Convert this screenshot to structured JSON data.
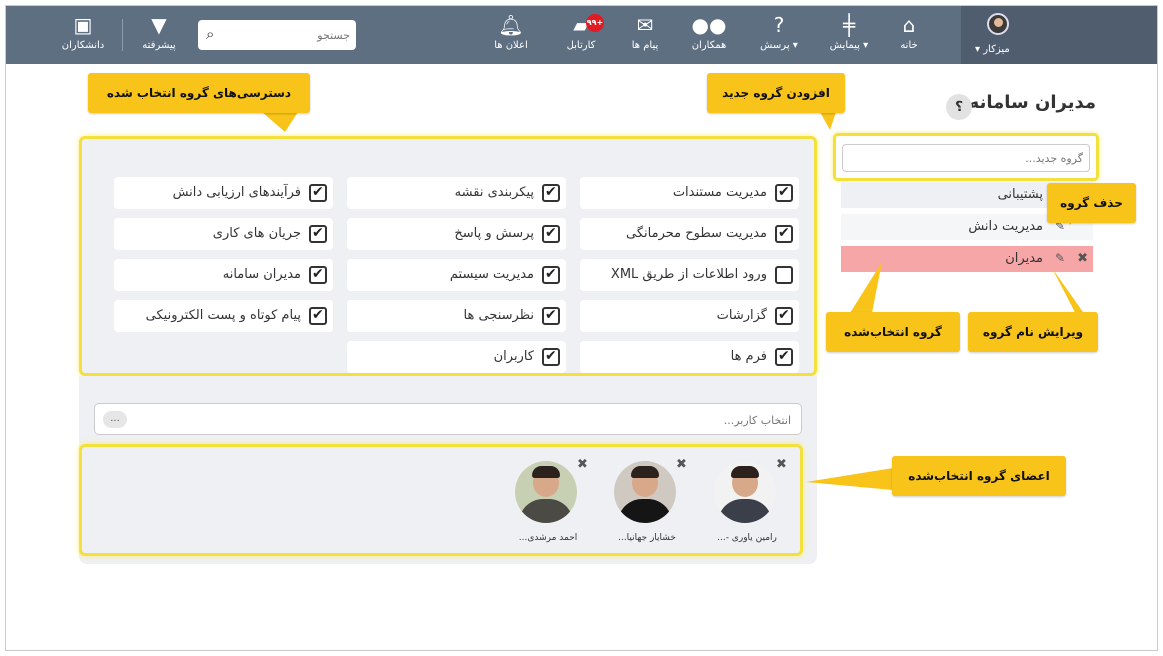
{
  "nav": {
    "user_name": "میزکار",
    "home": "خانه",
    "survey": "پیمایش",
    "question": "پرسش",
    "colleagues": "همکاران",
    "messages": "پیام ها",
    "cartable": "کارتابل",
    "cartable_badge": "۹۹+",
    "notifications": "اعلان ها",
    "search_placeholder": "جستجو",
    "advanced": "پیشرفته",
    "academics": "دانشکاران"
  },
  "groups": {
    "title": "مدیران سامانه",
    "help": "؟",
    "new_group_placeholder": "گروه جدید...",
    "items": [
      {
        "name": "پشتیبانی"
      },
      {
        "name": "مدیریت دانش"
      },
      {
        "name": "مدیران"
      }
    ]
  },
  "permissions": [
    {
      "label": "مدیریت مستندات",
      "checked": true
    },
    {
      "label": "پیکربندی نقشه",
      "checked": true
    },
    {
      "label": "فرآیندهای ارزیابی دانش",
      "checked": true
    },
    {
      "label": "مدیریت سطوح محرمانگی",
      "checked": true
    },
    {
      "label": "پرسش و پاسخ",
      "checked": true
    },
    {
      "label": "جریان های کاری",
      "checked": true
    },
    {
      "label": "ورود اطلاعات از طریق XML",
      "checked": false
    },
    {
      "label": "مدیریت سیستم",
      "checked": true
    },
    {
      "label": "مدیران سامانه",
      "checked": true
    },
    {
      "label": "گزارشات",
      "checked": true
    },
    {
      "label": "نظرسنجی ها",
      "checked": true
    },
    {
      "label": "پیام کوتاه و پست الکترونیکی",
      "checked": true
    },
    {
      "label": "فرم ها",
      "checked": true
    },
    {
      "label": "کاربران",
      "checked": true
    }
  ],
  "user_select": {
    "placeholder": "انتخاب کاربر...",
    "more": "..."
  },
  "members": [
    {
      "name": "رامین یاوری -..."
    },
    {
      "name": "خشایار جهانیا..."
    },
    {
      "name": "احمد مرشدی..."
    }
  ],
  "callouts": {
    "selected_permissions": "دسترسی‌های گروه انتخاب شده",
    "add_group": "افزودن گروه جدید",
    "delete_group": "حذف گروه",
    "selected_group": "گروه انتخاب‌شده",
    "edit_group_name": "ویرایش نام گروه",
    "group_members": "اعضای گروه انتخاب‌شده"
  },
  "colors": {
    "topbar": "#5f6f82",
    "highlight": "#f4e03c",
    "callout": "#f8c41a",
    "selected_group": "#f7a6a8",
    "badge": "#e01b24"
  }
}
